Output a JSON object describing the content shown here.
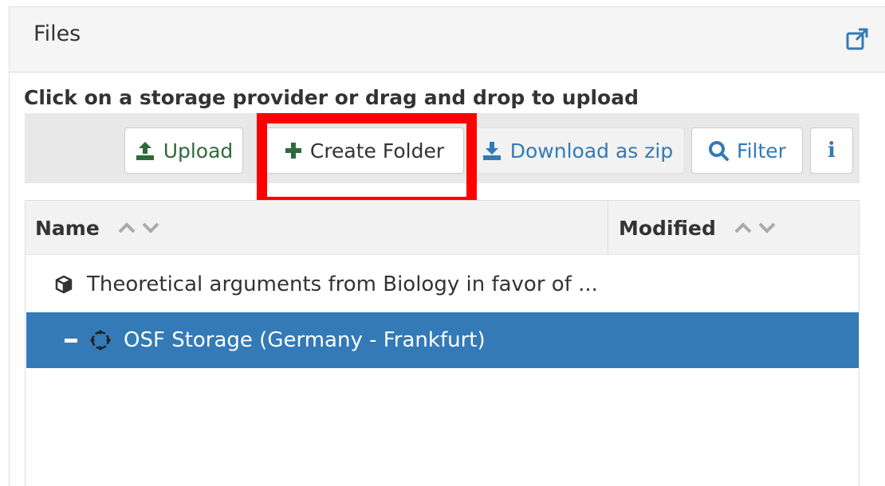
{
  "panel": {
    "title": "Files",
    "external_link_icon": "external-link-icon"
  },
  "instruction": "Click on a storage provider or drag and drop to upload",
  "toolbar": {
    "upload_label": "Upload",
    "create_folder_label": "Create Folder",
    "download_zip_label": "Download as zip",
    "filter_label": "Filter",
    "info_label": "i"
  },
  "grid": {
    "columns": [
      {
        "label": "Name"
      },
      {
        "label": "Modified"
      }
    ],
    "rows": [
      {
        "label": "Theoretical arguments from Biology in favor of ...",
        "icon": "cube-icon",
        "selected": false
      },
      {
        "label": "OSF Storage (Germany - Frankfurt)",
        "icon": "storage-icon",
        "toggle": "collapse",
        "selected": true
      }
    ]
  },
  "colors": {
    "accent": "#337ab7",
    "upload_green": "#2f6b3a",
    "highlight": "#ff0000",
    "selected_row": "#337ab7"
  }
}
